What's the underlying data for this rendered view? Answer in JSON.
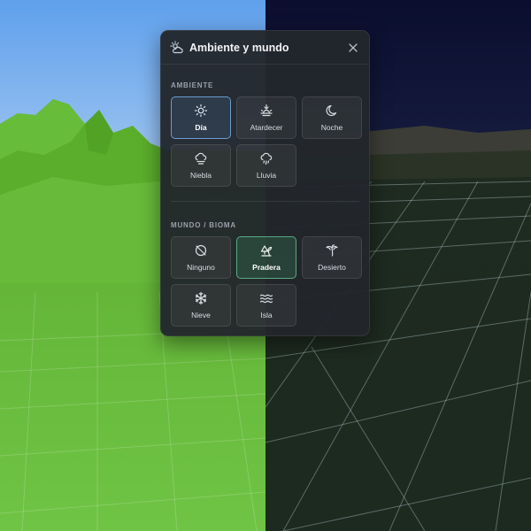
{
  "panel": {
    "title": "Ambiente y mundo",
    "close_icon": "close-icon",
    "header_icon": "sun-cloud-icon"
  },
  "ambiente": {
    "label": "AMBIENTE",
    "selected": "Día",
    "accent": "#6d9ccc",
    "items": [
      {
        "label": "Día",
        "icon": "sun-icon"
      },
      {
        "label": "Atardecer",
        "icon": "sunset-icon"
      },
      {
        "label": "Noche",
        "icon": "moon-icon"
      },
      {
        "label": "Niebla",
        "icon": "fog-icon"
      },
      {
        "label": "Lluvia",
        "icon": "rain-icon"
      }
    ]
  },
  "mundo": {
    "label": "MUNDO / BIOMA",
    "selected": "Pradera",
    "accent": "#58a983",
    "items": [
      {
        "label": "Ninguno",
        "icon": "none-icon"
      },
      {
        "label": "Pradera",
        "icon": "meadow-icon"
      },
      {
        "label": "Desierto",
        "icon": "palm-icon"
      },
      {
        "label": "Nieve",
        "icon": "snowflake-icon"
      },
      {
        "label": "Isla",
        "icon": "waves-icon"
      }
    ]
  },
  "scene": {
    "day_sky": "#7fb2f0",
    "night_sky": "#0e1233",
    "grass": "#6cc23e"
  }
}
